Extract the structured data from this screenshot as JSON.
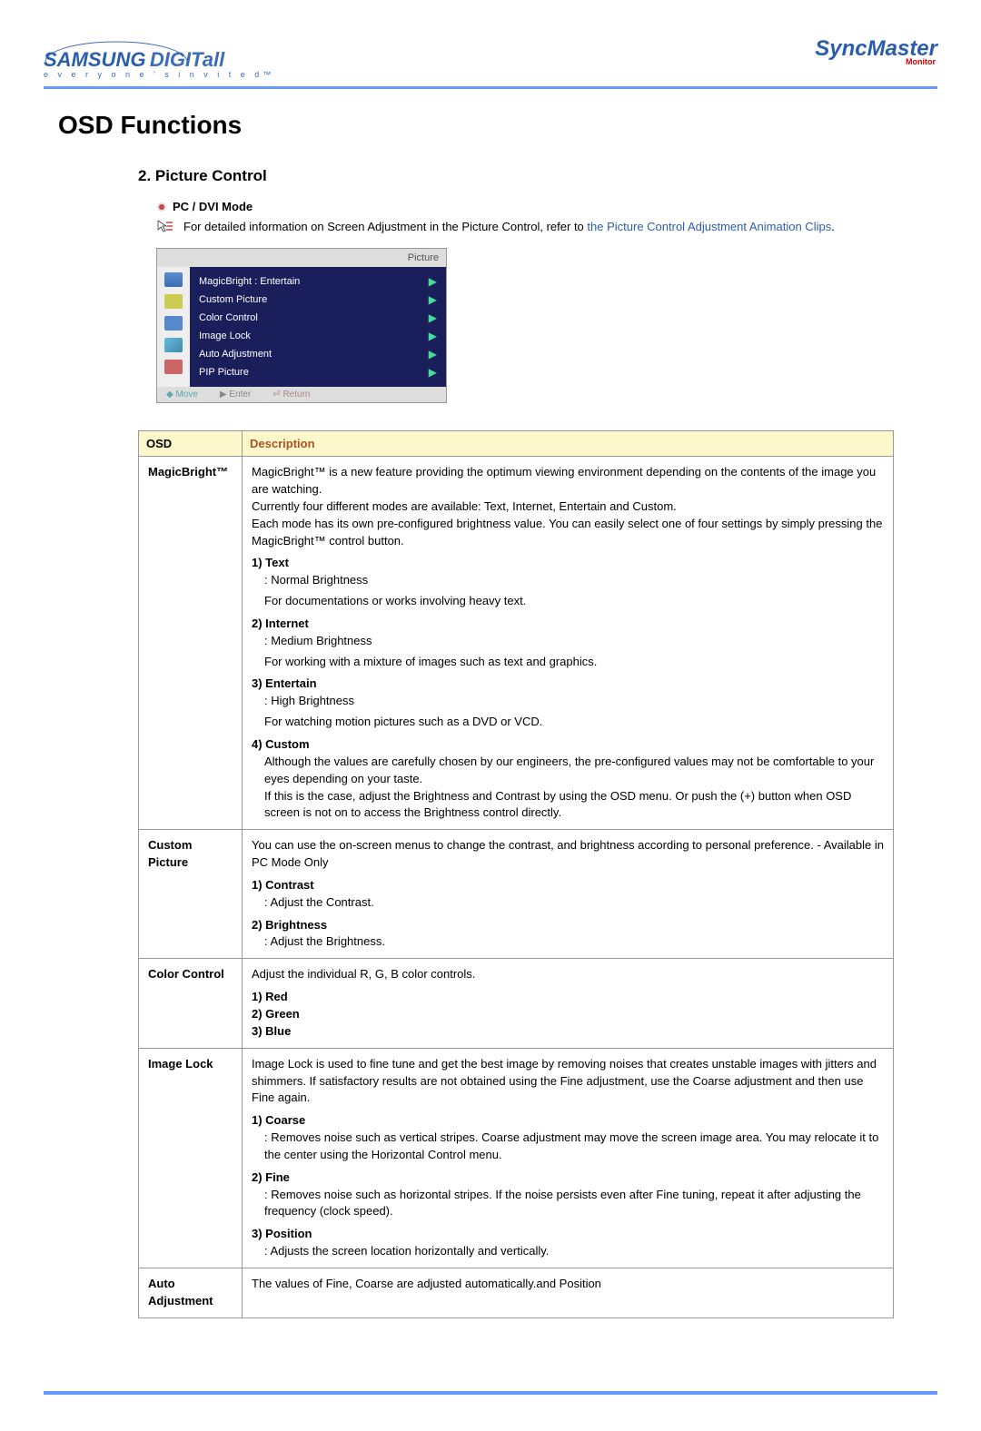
{
  "header": {
    "brand_left_1": "SAMSUNG",
    "brand_left_2": "DIGITall",
    "tagline": "e v e r y o n e ' s   i n v i t e d™",
    "brand_right": "SyncMaster",
    "brand_right_sub": "Monitor"
  },
  "title": "OSD Functions",
  "section": {
    "header": "2. Picture Control",
    "mode": "PC / DVI Mode",
    "info_pre": "For detailed information on Screen Adjustment in the Picture Control, refer to ",
    "info_link": "the Picture Control Adjustment Animation Clips",
    "info_post": "."
  },
  "osd_menu": {
    "top_label": "Picture",
    "items": [
      "MagicBright : Entertain",
      "Custom Picture",
      "Color Control",
      "Image Lock",
      "Auto Adjustment",
      "PIP Picture"
    ],
    "footer": {
      "move": "◆  Move",
      "enter": "▶ Enter",
      "return": "⏎ Return"
    }
  },
  "table": {
    "th1": "OSD",
    "th2": "Description",
    "rows": {
      "magicbright": {
        "label": "MagicBright™",
        "intro": "MagicBright™ is a new feature providing the optimum viewing environment depending on the contents of the image you are watching.\nCurrently four different modes are available: Text, Internet, Entertain and Custom.\nEach mode has its own pre-configured brightness value. You can easily select one of four settings by simply pressing the MagicBright™ control button.",
        "sub1_label": "1) Text",
        "sub1_a": ": Normal Brightness",
        "sub1_b": "For documentations or works involving heavy text.",
        "sub2_label": "2) Internet",
        "sub2_a": ": Medium Brightness",
        "sub2_b": "For working with a mixture of images such as text and graphics.",
        "sub3_label": "3) Entertain",
        "sub3_a": ": High Brightness",
        "sub3_b": "For watching motion pictures such as a DVD or VCD.",
        "sub4_label": "4) Custom",
        "sub4_body": "Although the values are carefully chosen by our engineers, the pre-configured values may not be comfortable to your eyes depending on your taste.\nIf this is the case, adjust the Brightness and Contrast by using the OSD menu. Or push the (+) button when OSD screen is not on to access the Brightness control directly."
      },
      "custom_picture": {
        "label": "Custom Picture",
        "intro": "You can use the on-screen menus to change the contrast, and brightness according to personal preference.  - Available in PC Mode Only",
        "sub1_label": "1) Contrast",
        "sub1_a": ": Adjust the Contrast.",
        "sub2_label": "2) Brightness",
        "sub2_a": ": Adjust the Brightness."
      },
      "color_control": {
        "label": "Color Control",
        "intro": "Adjust the individual R, G, B color controls.",
        "sub1": "1) Red",
        "sub2": "2) Green",
        "sub3": "3) Blue"
      },
      "image_lock": {
        "label": "Image Lock",
        "intro": "Image Lock is used to fine tune and get the best image by removing noises that creates unstable images with jitters and shimmers. If satisfactory results are not obtained using the Fine adjustment, use the Coarse adjustment and then use Fine again.",
        "sub1_label": "1) Coarse",
        "sub1_a": ": Removes noise such as vertical stripes. Coarse adjustment may move the screen image area. You may relocate it to the center using the Horizontal Control menu.",
        "sub2_label": "2) Fine",
        "sub2_a": ": Removes noise such as horizontal stripes. If the noise persists even after Fine tuning, repeat it after adjusting the frequency (clock speed).",
        "sub3_label": "3) Position",
        "sub3_a": ": Adjusts the screen location horizontally and vertically."
      },
      "auto_adjustment": {
        "label": "Auto Adjustment",
        "intro": "The values of Fine, Coarse are adjusted automatically.and Position"
      }
    }
  }
}
